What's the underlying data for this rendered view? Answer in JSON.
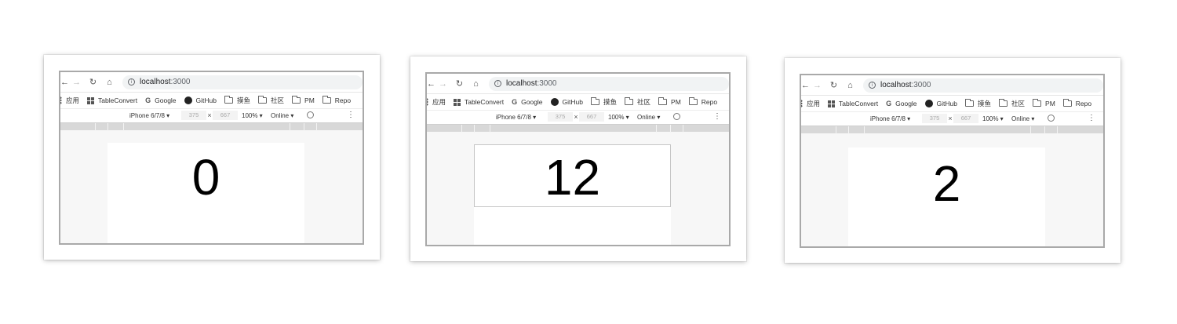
{
  "browser": {
    "url_host": "localhost",
    "url_port": ":3000",
    "bookmarks": {
      "apps": "应用",
      "tableconvert": "TableConvert",
      "google": "Google",
      "github": "GitHub",
      "moyu": "摸鱼",
      "community": "社区",
      "pm": "PM",
      "repo": "Repo"
    },
    "devtools": {
      "device": "iPhone 6/7/8 ▾",
      "width": "375",
      "times": "×",
      "height": "667",
      "zoom": "100% ▾",
      "network": "Online ▾"
    }
  },
  "screens": [
    {
      "counter": "0"
    },
    {
      "counter": "12"
    },
    {
      "counter": "2"
    }
  ]
}
